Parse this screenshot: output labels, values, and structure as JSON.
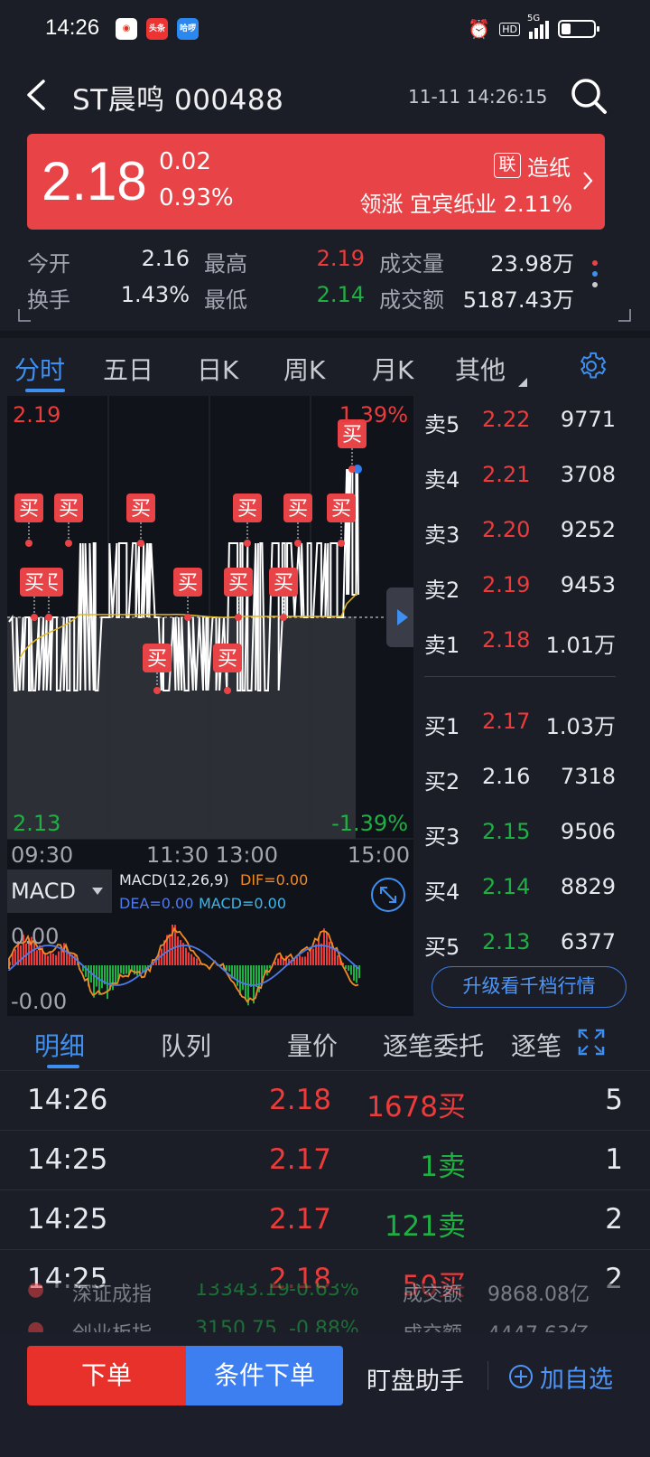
{
  "status_bar": {
    "time": "14:26",
    "apps": [
      "头条",
      "哈啰"
    ],
    "network": "5G",
    "hd": "HD"
  },
  "header": {
    "title": "ST晨鸣 000488",
    "datetime": "11-11 14:26:15"
  },
  "quote": {
    "price": "2.18",
    "change": "0.02",
    "change_pct": "0.93%",
    "sector_badge": "联",
    "sector": "造纸",
    "leader": "领涨 宜宾纸业 2.11%",
    "color": "#e84447"
  },
  "stats": {
    "open_label": "今开",
    "open_value": "2.16",
    "high_label": "最高",
    "high_value": "2.19",
    "volume_label": "成交量",
    "volume_value": "23.98万",
    "turnover_label": "换手",
    "turnover_value": "1.43%",
    "low_label": "最低",
    "low_value": "2.14",
    "amount_label": "成交额",
    "amount_value": "5187.43万"
  },
  "chart_tabs": [
    "分时",
    "五日",
    "日K",
    "周K",
    "月K",
    "其他"
  ],
  "chart": {
    "y_max_label": "2.19",
    "y_min_label": "2.13",
    "pct_max_label": "1.39%",
    "pct_min_label": "-1.39%",
    "x_labels": [
      "09:30",
      "11:30 13:00",
      "15:00"
    ],
    "buy_marker": "买",
    "indicator_select": "MACD",
    "macd_title": "MACD(12,26,9)",
    "dif": "DIF=0.00",
    "dea": "DEA=0.00",
    "macd": "MACD=0.00",
    "macd_top": "0.00",
    "macd_bottom": "-0.00"
  },
  "order_book": {
    "sell": [
      {
        "label": "卖5",
        "price": "2.22",
        "volume": "9771"
      },
      {
        "label": "卖4",
        "price": "2.21",
        "volume": "3708"
      },
      {
        "label": "卖3",
        "price": "2.20",
        "volume": "9252"
      },
      {
        "label": "卖2",
        "price": "2.19",
        "volume": "9453"
      },
      {
        "label": "卖1",
        "price": "2.18",
        "volume": "1.01万"
      }
    ],
    "buy": [
      {
        "label": "买1",
        "price": "2.17",
        "volume": "1.03万"
      },
      {
        "label": "买2",
        "price": "2.16",
        "volume": "7318"
      },
      {
        "label": "买3",
        "price": "2.15",
        "volume": "9506"
      },
      {
        "label": "买4",
        "price": "2.14",
        "volume": "8829"
      },
      {
        "label": "买5",
        "price": "2.13",
        "volume": "6377"
      }
    ],
    "upgrade_label": "升级看千档行情"
  },
  "detail_tabs": [
    "明细",
    "队列",
    "量价",
    "逐笔委托",
    "逐笔"
  ],
  "trades": [
    {
      "time": "14:26",
      "price": "2.18",
      "volume": "1678买",
      "count": "5"
    },
    {
      "time": "14:25",
      "price": "2.17",
      "volume": "1卖",
      "count": "1"
    },
    {
      "time": "14:25",
      "price": "2.17",
      "volume": "121卖",
      "count": "2"
    },
    {
      "time": "14:25",
      "price": "2.18",
      "volume": "50买",
      "count": "2"
    }
  ],
  "ticker": [
    {
      "name": "深证成指",
      "value": "13343.19",
      "pct": "-0.63%",
      "label": "成交额",
      "amount": "9868.08亿"
    },
    {
      "name": "创业板指",
      "value": "3150.75",
      "pct": "-0.88%",
      "label": "成交额",
      "amount": "4447.63亿"
    }
  ],
  "bottom": {
    "order": "下单",
    "conditional": "条件下单",
    "assistant": "盯盘助手",
    "favorite": "加自选"
  }
}
